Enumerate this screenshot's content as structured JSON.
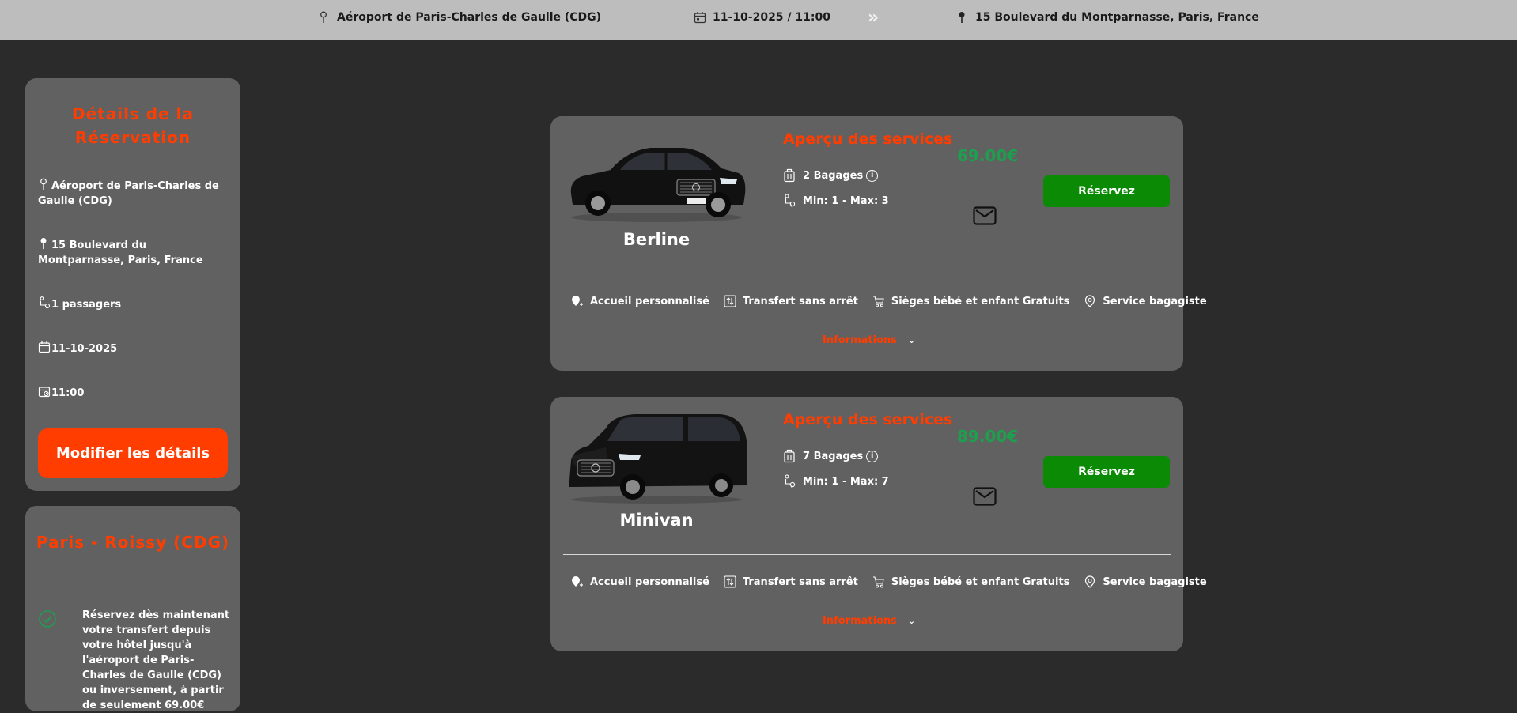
{
  "topbar": {
    "origin": "Aéroport de Paris-Charles de Gaulle (CDG)",
    "datetime": "11-10-2025 / 11:00",
    "arrow": "»",
    "destination": "15 Boulevard du Montparnasse, Paris, France"
  },
  "booking": {
    "title": "Détails de la Réservation",
    "origin": "Aéroport de Paris-Charles de Gaulle (CDG)",
    "destination": "15 Boulevard du Montparnasse, Paris, France",
    "passengers": "1 passagers",
    "date": "11-10-2025",
    "time": "11:00",
    "modify_label": "Modifier les détails"
  },
  "promo": {
    "title": "Paris - Roissy (CDG)",
    "text": "Réservez dès maintenant votre transfert depuis votre hôtel jusqu'à l'aéroport de Paris-Charles de Gaulle (CDG) ou inversement, à partir de seulement 69.00€"
  },
  "vehicles": [
    {
      "name": "Berline",
      "services_title": "Aperçu des services",
      "bags": "2 Bagages",
      "pax": "Min: 1 - Max: 3",
      "price": "69.00€",
      "book_label": "Réservez",
      "features": [
        "Accueil personnalisé",
        "Transfert sans arrêt",
        "Sièges bébé et enfant Gratuits",
        "Service bagagiste"
      ],
      "more_label": "Informations"
    },
    {
      "name": "Minivan",
      "services_title": "Aperçu des services",
      "bags": "7 Bagages",
      "pax": "Min: 1 - Max: 7",
      "price": "89.00€",
      "book_label": "Réservez",
      "features": [
        "Accueil personnalisé",
        "Transfert sans arrêt",
        "Sièges bébé et enfant Gratuits",
        "Service bagagiste"
      ],
      "more_label": "Informations"
    }
  ],
  "colors": {
    "accent": "#ff3d00",
    "price": "#1e9e4e",
    "book": "#0b8a06",
    "card": "#616161",
    "background": "#2b2b2b",
    "topbar": "#bdbdbd"
  },
  "icons": {
    "origin": "pin-outline-icon",
    "destination": "pin-filled-icon",
    "date": "calendar-icon",
    "time": "clock-calendar-icon",
    "passengers": "passenger-icon",
    "bags": "luggage-icon",
    "info": "info-icon",
    "mail": "mail-icon",
    "check": "check-circle-icon",
    "chevron": "chevron-down-icon"
  }
}
